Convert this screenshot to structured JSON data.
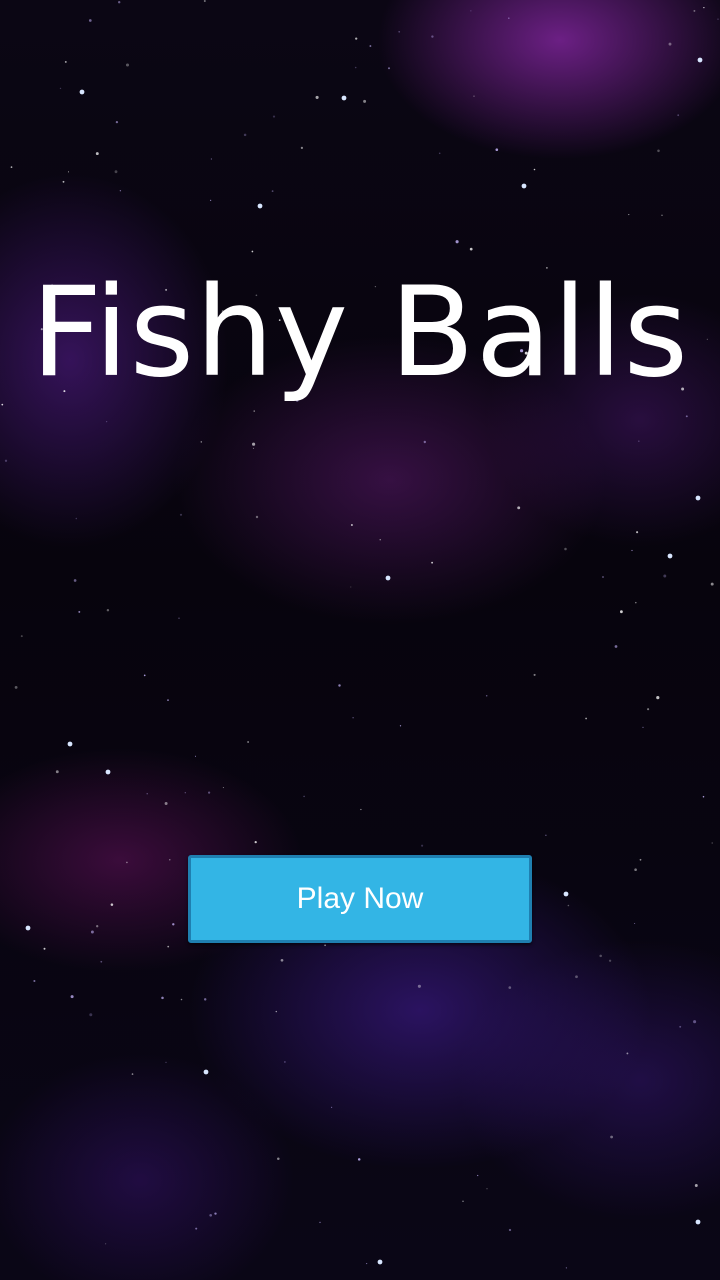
{
  "game": {
    "title": "Fishy Balls",
    "play_button_label": "Play Now"
  },
  "theme": {
    "background": "space-nebula",
    "button_color": "#33b5e5",
    "button_border_color": "#1f7fb0",
    "title_color": "#ffffff"
  }
}
